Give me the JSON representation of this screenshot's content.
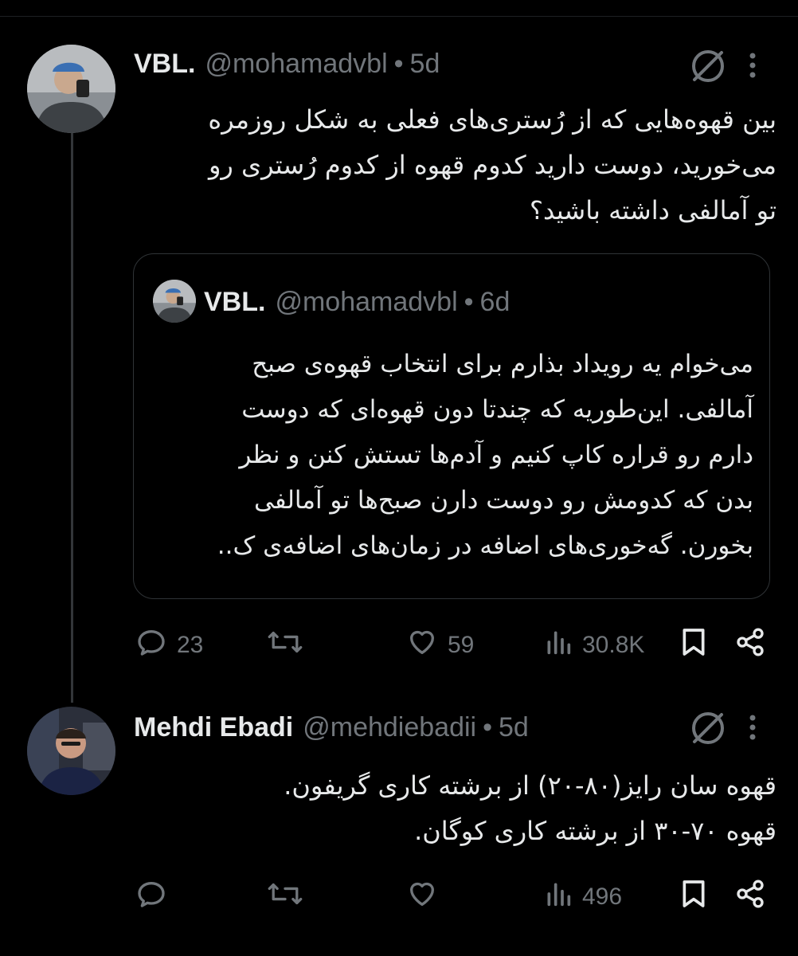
{
  "thread": [
    {
      "author_name": "VBL.",
      "handle": "@mohamadvbl",
      "separator": "•",
      "age": "5d",
      "text": "بین قهوه‌هایی که از رُستری‌های فعلی به شکل روزمره\nمی‌خورید، دوست دارید کدوم قهوه از کدوم رُستری رو\nتو آمالفی داشته باشید؟",
      "quote": {
        "author_name": "VBL.",
        "handle": "@mohamadvbl",
        "separator": "•",
        "age": "6d",
        "text": "می‌خوام یه رویداد بذارم برای انتخاب قهوه‌ی صبح\nآمالفی. این‌طوریه که چندتا دون قهوه‌ای که دوست\nدارم رو قراره کاپ کنیم و آدم‌ها تستش کنن و نظر\nبدن که کدومش رو دوست دارن صبح‌ها تو آمالفی\nبخورن. گه‌خوری‌های اضافه در زمان‌های اضافه‌ی ک.."
      },
      "actions": {
        "replies": "23",
        "retweets": "",
        "likes": "59",
        "views": "30.8K"
      }
    },
    {
      "author_name": "Mehdi Ebadi",
      "handle": "@mehdiebadii",
      "separator": "•",
      "age": "5d",
      "text": "قهوه سان رایز(۸۰-۲۰) از برشته کاری گریفون.\nقهوه ۷۰-۳۰ از برشته کاری کوگان.",
      "actions": {
        "replies": "",
        "retweets": "",
        "likes": "",
        "views": "496"
      }
    }
  ],
  "icons": {
    "reply": "reply-icon",
    "retweet": "retweet-icon",
    "like": "heart-icon",
    "views": "views-icon",
    "bookmark": "bookmark-icon",
    "share": "share-icon",
    "grok": "grok-icon",
    "more": "more-dots-icon"
  },
  "colors": {
    "background": "#000000",
    "text": "#e7e9ea",
    "muted": "#71767b",
    "border": "#2f3336"
  }
}
